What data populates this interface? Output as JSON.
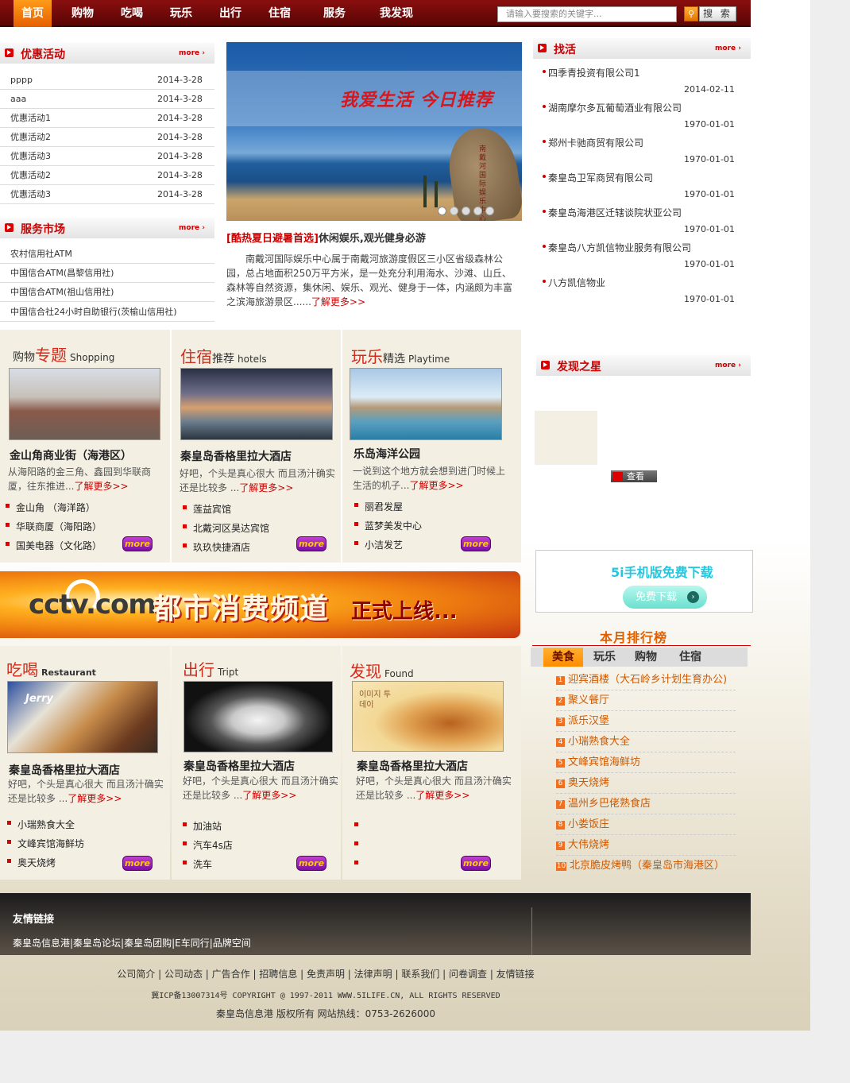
{
  "nav": {
    "items": [
      "首页",
      "购物",
      "吃喝",
      "玩乐",
      "出行",
      "住宿",
      "服务",
      "我发现"
    ],
    "search_placeholder": "请输入要搜索的关键字...",
    "search_button": "搜 索"
  },
  "promo": {
    "title": "优惠活动",
    "more": "more",
    "items": [
      {
        "title": "pppp",
        "date": "2014-3-28"
      },
      {
        "title": "aaa",
        "date": "2014-3-28"
      },
      {
        "title": "优惠活动1",
        "date": "2014-3-28"
      },
      {
        "title": "优惠活动2",
        "date": "2014-3-28"
      },
      {
        "title": "优惠活动3",
        "date": "2014-3-28"
      },
      {
        "title": "优惠活动2",
        "date": "2014-3-28"
      },
      {
        "title": "优惠活动3",
        "date": "2014-3-28"
      }
    ]
  },
  "service": {
    "title": "服务市场",
    "more": "more",
    "items": [
      "农村信用社ATM",
      "中国信合ATM(昌黎信用社)",
      "中国信合ATM(祖山信用社)",
      "中国信合社24小时自助银行(茨榆山信用社)"
    ]
  },
  "banner": {
    "slogan": "我爱生活 今日推荐",
    "rock_text": "南戴河国际娱乐中心"
  },
  "feature": {
    "title_bracket": "[酷热夏日避暑首选]",
    "title_rest": "休闲娱乐,观光健身必游",
    "body": "南戴河国际娱乐中心属于南戴河旅游度假区三小区省级森林公园，总占地面积250万平方米，是一处充分利用海水、沙滩、山丘、森林等自然资源，集休闲、娱乐、观光、健身于一体，内涵颇为丰富之滨海旅游景区......",
    "more": "了解更多>>"
  },
  "jobs": {
    "title": "找活",
    "more": "more",
    "items": [
      {
        "name": "四季青投资有限公司1",
        "date": "2014-02-11"
      },
      {
        "name": "湖南摩尔多瓦葡萄酒业有限公司",
        "date": "1970-01-01"
      },
      {
        "name": "郑州卡驰商贸有限公司",
        "date": "1970-01-01"
      },
      {
        "name": "秦皇岛卫军商贸有限公司",
        "date": "1970-01-01"
      },
      {
        "name": "秦皇岛海港区迁辖谈院状亚公司",
        "date": "1970-01-01"
      },
      {
        "name": "秦皇岛八方凯信物业服务有限公司",
        "date": "1970-01-01"
      },
      {
        "name": "八方凯信物业",
        "date": "1970-01-01"
      }
    ]
  },
  "star": {
    "title": "发现之星",
    "more": "more",
    "view": "查看"
  },
  "shopping": {
    "t1": "购物",
    "t2": "专题",
    "en": "Shopping",
    "name": "金山角商业街（海港区）",
    "desc": "从海阳路的金三角、鑫园到华联商厦，往东推进...",
    "more": "了解更多>>",
    "items": [
      "金山角 （海洋路）",
      "华联商厦（海阳路）",
      "国美电器（文化路）"
    ],
    "more_btn": "more"
  },
  "hotel": {
    "t1": "住宿",
    "t2": "推荐",
    "en": "hotels",
    "name": "秦皇岛香格里拉大酒店",
    "desc": "好吧，个头是真心很大 而且汤汁确实还是比较多 ...",
    "more": "了解更多>>",
    "items": [
      "莲益宾馆",
      "北戴河区昊达宾馆",
      "玖玖快捷酒店"
    ],
    "more_btn": "more"
  },
  "play": {
    "t1": "玩乐",
    "t2": "精选",
    "en": "Playtime",
    "name": "乐岛海洋公园",
    "desc": "一说到这个地方就会想到进门时候上生活的机子...",
    "more": "了解更多>>",
    "items": [
      "丽君发屋",
      "蓝梦美发中心",
      "小洁发艺"
    ],
    "more_btn": "more"
  },
  "cctv": {
    "logo": "cctv.com",
    "big": "都市消费频道",
    "small": "正式上线..."
  },
  "eat": {
    "t1": "吃喝",
    "en": "Restaurant",
    "name": "秦皇岛香格里拉大酒店",
    "desc": "好吧，个头是真心很大 而且汤汁确实还是比较多 ...",
    "more": "了解更多>>",
    "items": [
      "小瑞熟食大全",
      "文峰宾馆海鲜坊",
      "奥天烧烤"
    ],
    "more_btn": "more",
    "img_text": "Jerry"
  },
  "travel": {
    "t1": "出行",
    "en": "Tript",
    "name": "秦皇岛香格里拉大酒店",
    "desc": "好吧，个头是真心很大 而且汤汁确实还是比较多 ...",
    "more": "了解更多>>",
    "items": [
      "加油站",
      "汽车4s店",
      "洗车"
    ],
    "more_btn": "more"
  },
  "found": {
    "t1": "发现",
    "en": "Found",
    "name": "秦皇岛香格里拉大酒店",
    "desc": "好吧，个头是真心很大 而且汤汁确实还是比较多 ...",
    "more": "了解更多>>",
    "more_btn": "more",
    "img_text": "이미지 투데이"
  },
  "mobile": {
    "title": "5i手机版免费下载",
    "button": "免费下载"
  },
  "rank": {
    "title": "本月排行榜",
    "tabs": [
      "美食",
      "玩乐",
      "购物",
      "住宿"
    ],
    "items": [
      {
        "n": "1",
        "name": "迎宾酒楼（大石岭乡计划生育办公)"
      },
      {
        "n": "2",
        "name": "聚义餐厅"
      },
      {
        "n": "3",
        "name": "派乐汉堡"
      },
      {
        "n": "4",
        "name": "小瑞熟食大全"
      },
      {
        "n": "5",
        "name": "文峰宾馆海鲜坊"
      },
      {
        "n": "6",
        "name": "奥天烧烤"
      },
      {
        "n": "7",
        "name": "温州乡巴佬熟食店"
      },
      {
        "n": "8",
        "name": "小娄饭庄"
      },
      {
        "n": "9",
        "name": "大伟烧烤"
      },
      {
        "n": "10",
        "name": "北京脆皮烤鸭（秦皇岛市海港区）"
      }
    ]
  },
  "friends": {
    "title": "友情链接",
    "links": "秦皇岛信息港|秦皇岛论坛|秦皇岛团购|E车同行|品牌空间"
  },
  "footer": {
    "links": "公司简介 | 公司动态 | 广告合作 | 招聘信息 | 免责声明 | 法律声明 | 联系我们 | 问卷调查 | 友情链接",
    "copyright": "冀ICP备13007314号 COPYRIGHT @ 1997-2011 WWW.5ILIFE.CN, ALL RIGHTS RESERVED",
    "owner": "秦皇岛信息港 版权所有 网站热线：0753-2626000"
  }
}
